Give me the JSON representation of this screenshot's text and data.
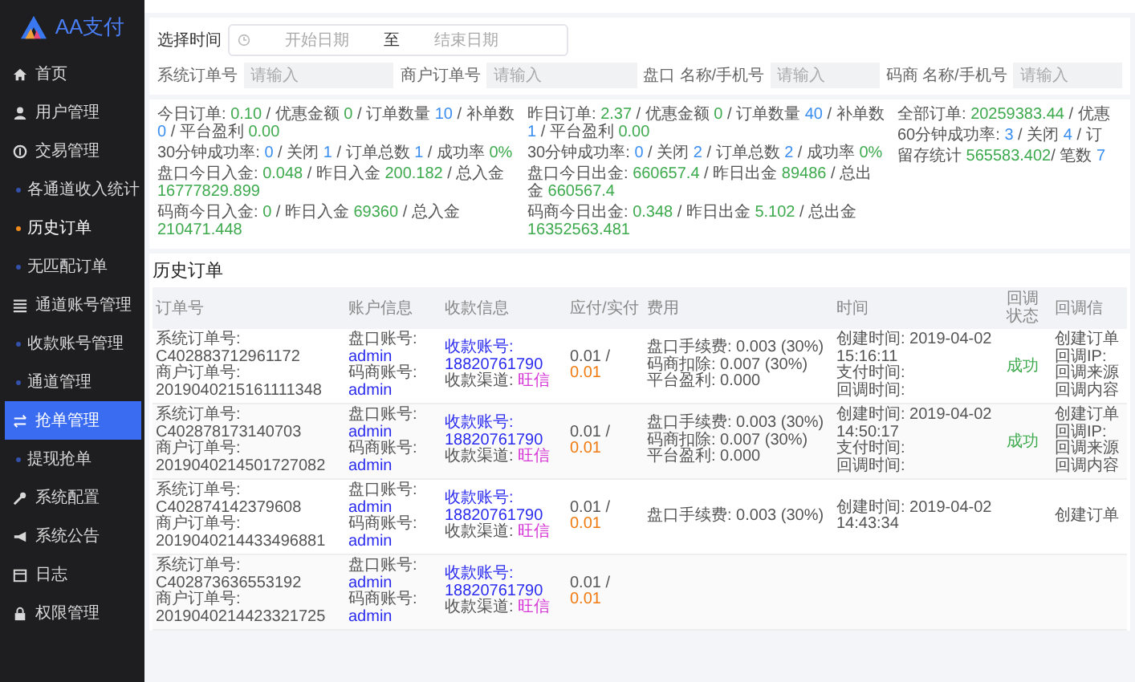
{
  "sidebar": {
    "logo": "AA支付",
    "items": [
      {
        "label": "首页",
        "selected": false
      },
      {
        "label": "用户管理",
        "selected": false
      },
      {
        "label": "交易管理",
        "selected": false,
        "children": [
          {
            "label": "各通道收入统计",
            "selected": false
          },
          {
            "label": "历史订单",
            "selected": true
          },
          {
            "label": "无匹配订单",
            "selected": false
          }
        ]
      },
      {
        "label": "通道账号管理",
        "selected": false,
        "children": [
          {
            "label": "收款账号管理",
            "selected": false
          },
          {
            "label": "通道管理",
            "selected": false
          }
        ]
      },
      {
        "label": "抢单管理",
        "selected": true,
        "children": [
          {
            "label": "提现抢单",
            "selected": false
          }
        ]
      },
      {
        "label": "系统配置",
        "selected": false
      },
      {
        "label": "系统公告",
        "selected": false
      },
      {
        "label": "日志",
        "selected": false
      },
      {
        "label": "权限管理",
        "selected": false
      }
    ]
  },
  "filters": {
    "date_label": "选择时间",
    "start_placeholder": "开始日期",
    "separator": "至",
    "end_placeholder": "结束日期",
    "fields": [
      {
        "label": "系统订单号",
        "placeholder": "请输入"
      },
      {
        "label": "商户订单号",
        "placeholder": "请输入"
      },
      {
        "label": "盘口 名称/手机号",
        "placeholder": "请输入"
      },
      {
        "label": "码商 名称/手机号",
        "placeholder": "请输入"
      }
    ]
  },
  "stats": {
    "columns": [
      [
        [
          {
            "text": "今日订单: ",
            "kind": "plain"
          },
          {
            "text": "0.10",
            "kind": "green"
          },
          {
            "text": " / 优惠金额 ",
            "kind": "plain"
          },
          {
            "text": "0",
            "kind": "green"
          },
          {
            "text": " / 订单数量 ",
            "kind": "plain"
          },
          {
            "text": "10",
            "kind": "blue"
          },
          {
            "text": " / 补单数 ",
            "kind": "plain"
          },
          {
            "text": "0",
            "kind": "blue"
          },
          {
            "text": " / 平台盈利 ",
            "kind": "plain"
          },
          {
            "text": "0.00",
            "kind": "green"
          }
        ],
        [
          {
            "text": "30分钟成功率: ",
            "kind": "plain"
          },
          {
            "text": "0",
            "kind": "blue"
          },
          {
            "text": " / 关闭 ",
            "kind": "plain"
          },
          {
            "text": "1",
            "kind": "blue"
          },
          {
            "text": " / 订单总数 ",
            "kind": "plain"
          },
          {
            "text": "1",
            "kind": "blue"
          },
          {
            "text": " / 成功率 ",
            "kind": "plain"
          },
          {
            "text": "0%",
            "kind": "green"
          }
        ],
        [
          {
            "text": "盘口今日入金: ",
            "kind": "plain"
          },
          {
            "text": "0.048",
            "kind": "green"
          },
          {
            "text": " / 昨日入金 ",
            "kind": "plain"
          },
          {
            "text": "200.182",
            "kind": "green"
          },
          {
            "text": " / 总入金 ",
            "kind": "plain"
          },
          {
            "text": "16777829.899",
            "kind": "green"
          }
        ],
        [
          {
            "text": "码商今日入金: ",
            "kind": "plain"
          },
          {
            "text": "0",
            "kind": "green"
          },
          {
            "text": " / 昨日入金 ",
            "kind": "plain"
          },
          {
            "text": "69360",
            "kind": "green"
          },
          {
            "text": " / 总入金 ",
            "kind": "plain"
          },
          {
            "text": "210471.448",
            "kind": "green"
          }
        ]
      ],
      [
        [
          {
            "text": "昨日订单: ",
            "kind": "plain"
          },
          {
            "text": "2.37",
            "kind": "green"
          },
          {
            "text": " / 优惠金额 ",
            "kind": "plain"
          },
          {
            "text": "0",
            "kind": "green"
          },
          {
            "text": " / 订单数量 ",
            "kind": "plain"
          },
          {
            "text": "40",
            "kind": "blue"
          },
          {
            "text": " / 补单数 ",
            "kind": "plain"
          },
          {
            "text": "1",
            "kind": "blue"
          },
          {
            "text": " / 平台盈利 ",
            "kind": "plain"
          },
          {
            "text": "0.00",
            "kind": "green"
          }
        ],
        [
          {
            "text": "30分钟成功率: ",
            "kind": "plain"
          },
          {
            "text": "0",
            "kind": "blue"
          },
          {
            "text": " / 关闭 ",
            "kind": "plain"
          },
          {
            "text": "2",
            "kind": "blue"
          },
          {
            "text": " / 订单总数 ",
            "kind": "plain"
          },
          {
            "text": "2",
            "kind": "blue"
          },
          {
            "text": " / 成功率 ",
            "kind": "plain"
          },
          {
            "text": "0%",
            "kind": "green"
          }
        ],
        [
          {
            "text": "盘口今日出金: ",
            "kind": "plain"
          },
          {
            "text": "660657.4",
            "kind": "green"
          },
          {
            "text": " / 昨日出金 ",
            "kind": "plain"
          },
          {
            "text": "89486",
            "kind": "green"
          },
          {
            "text": " / 总出金 ",
            "kind": "plain"
          },
          {
            "text": "660567.4",
            "kind": "green"
          }
        ],
        [
          {
            "text": "码商今日出金: ",
            "kind": "plain"
          },
          {
            "text": "0.348",
            "kind": "green"
          },
          {
            "text": " / 昨日出金 ",
            "kind": "plain"
          },
          {
            "text": "5.102",
            "kind": "green"
          },
          {
            "text": " / 总出金 ",
            "kind": "plain"
          },
          {
            "text": "16352563.481",
            "kind": "green"
          }
        ]
      ],
      [
        [
          {
            "text": "全部订单: ",
            "kind": "plain"
          },
          {
            "text": "20259383.44",
            "kind": "green"
          },
          {
            "text": " / 优惠",
            "kind": "plain"
          }
        ],
        [
          {
            "text": "60分钟成功率: ",
            "kind": "plain"
          },
          {
            "text": "3",
            "kind": "blue"
          },
          {
            "text": " / 关闭 ",
            "kind": "plain"
          },
          {
            "text": "4",
            "kind": "blue"
          },
          {
            "text": " / 订",
            "kind": "plain"
          }
        ],
        [
          {
            "text": "留存统计 ",
            "kind": "plain"
          },
          {
            "text": "565583.402",
            "kind": "green"
          },
          {
            "text": "/ 笔数 ",
            "kind": "plain"
          },
          {
            "text": "7",
            "kind": "blue"
          }
        ]
      ]
    ]
  },
  "history": {
    "title": "历史订单",
    "columns": [
      "订单号",
      "账户信息",
      "收款信息",
      "应付/实付",
      "费用",
      "时间",
      "回调状态",
      "回调信"
    ],
    "rows": [
      {
        "order": [
          [
            {
              "text": "系统订单号: C402883712961172",
              "kind": "plain"
            }
          ],
          [
            {
              "text": "商户订单号: 2019040215161111348",
              "kind": "plain"
            }
          ]
        ],
        "account": [
          [
            {
              "text": "盘口账号: ",
              "kind": "plain"
            },
            {
              "text": "admin",
              "kind": "link"
            }
          ],
          [
            {
              "text": "码商账号: ",
              "kind": "plain"
            },
            {
              "text": "admin",
              "kind": "link"
            }
          ]
        ],
        "receipt": [
          [
            {
              "text": "收款账号: 18820761790",
              "kind": "link"
            }
          ],
          [
            {
              "text": "收款渠道: ",
              "kind": "plain"
            },
            {
              "text": "旺信",
              "kind": "pink"
            }
          ]
        ],
        "amount": [
          [
            {
              "text": "0.01 / ",
              "kind": "plain"
            },
            {
              "text": "0.01",
              "kind": "orange"
            }
          ]
        ],
        "fees": [
          [
            {
              "text": "盘口手续费: 0.003 (30%)",
              "kind": "plain"
            }
          ],
          [
            {
              "text": "码商扣除: 0.007 (30%)",
              "kind": "plain"
            }
          ],
          [
            {
              "text": "平台盈利: 0.000",
              "kind": "plain"
            }
          ]
        ],
        "times": [
          [
            {
              "text": "创建时间: 2019-04-02 15:16:11",
              "kind": "plain"
            }
          ],
          [
            {
              "text": "支付时间:",
              "kind": "plain"
            }
          ],
          [
            {
              "text": "回调时间:",
              "kind": "plain"
            }
          ]
        ],
        "status": "成功",
        "callback": [
          [
            {
              "text": "创建订单",
              "kind": "plain"
            }
          ],
          [
            {
              "text": "回调IP:",
              "kind": "plain"
            }
          ],
          [
            {
              "text": "回调来源",
              "kind": "plain"
            }
          ],
          [
            {
              "text": "回调内容",
              "kind": "plain"
            }
          ]
        ]
      },
      {
        "order": [
          [
            {
              "text": "系统订单号: C402878173140703",
              "kind": "plain"
            }
          ],
          [
            {
              "text": "商户订单号: 2019040214501727082",
              "kind": "plain"
            }
          ]
        ],
        "account": [
          [
            {
              "text": "盘口账号: ",
              "kind": "plain"
            },
            {
              "text": "admin",
              "kind": "link"
            }
          ],
          [
            {
              "text": "码商账号: ",
              "kind": "plain"
            },
            {
              "text": "admin",
              "kind": "link"
            }
          ]
        ],
        "receipt": [
          [
            {
              "text": "收款账号: 18820761790",
              "kind": "link"
            }
          ],
          [
            {
              "text": "收款渠道: ",
              "kind": "plain"
            },
            {
              "text": "旺信",
              "kind": "pink"
            }
          ]
        ],
        "amount": [
          [
            {
              "text": "0.01 / ",
              "kind": "plain"
            },
            {
              "text": "0.01",
              "kind": "orange"
            }
          ]
        ],
        "fees": [
          [
            {
              "text": "盘口手续费: 0.003 (30%)",
              "kind": "plain"
            }
          ],
          [
            {
              "text": "码商扣除: 0.007 (30%)",
              "kind": "plain"
            }
          ],
          [
            {
              "text": "平台盈利: 0.000",
              "kind": "plain"
            }
          ]
        ],
        "times": [
          [
            {
              "text": "创建时间: 2019-04-02 14:50:17",
              "kind": "plain"
            }
          ],
          [
            {
              "text": "支付时间:",
              "kind": "plain"
            }
          ],
          [
            {
              "text": "回调时间:",
              "kind": "plain"
            }
          ]
        ],
        "status": "成功",
        "callback": [
          [
            {
              "text": "创建订单",
              "kind": "plain"
            }
          ],
          [
            {
              "text": "回调IP:",
              "kind": "plain"
            }
          ],
          [
            {
              "text": "回调来源",
              "kind": "plain"
            }
          ],
          [
            {
              "text": "回调内容",
              "kind": "plain"
            }
          ]
        ]
      },
      {
        "order": [
          [
            {
              "text": "系统订单号: C402874142379608",
              "kind": "plain"
            }
          ],
          [
            {
              "text": "商户订单号: 2019040214433496881",
              "kind": "plain"
            }
          ]
        ],
        "account": [
          [
            {
              "text": "盘口账号: ",
              "kind": "plain"
            },
            {
              "text": "admin",
              "kind": "link"
            }
          ],
          [
            {
              "text": "码商账号: ",
              "kind": "plain"
            },
            {
              "text": "admin",
              "kind": "link"
            }
          ]
        ],
        "receipt": [
          [
            {
              "text": "收款账号: 18820761790",
              "kind": "link"
            }
          ],
          [
            {
              "text": "收款渠道: ",
              "kind": "plain"
            },
            {
              "text": "旺信",
              "kind": "pink"
            }
          ]
        ],
        "amount": [
          [
            {
              "text": "0.01 / ",
              "kind": "plain"
            },
            {
              "text": "0.01",
              "kind": "orange"
            }
          ]
        ],
        "fees": [
          [
            {
              "text": "盘口手续费: 0.003 (30%)",
              "kind": "plain"
            }
          ]
        ],
        "times": [
          [
            {
              "text": "创建时间: 2019-04-02 14:43:34",
              "kind": "plain"
            }
          ]
        ],
        "callback": [
          [
            {
              "text": "创建订单",
              "kind": "plain"
            }
          ]
        ]
      },
      {
        "order": [
          [
            {
              "text": "系统订单号: C402873636553192",
              "kind": "plain"
            }
          ],
          [
            {
              "text": "商户订单号: 2019040214423321725",
              "kind": "plain"
            }
          ]
        ],
        "account": [
          [
            {
              "text": "盘口账号: ",
              "kind": "plain"
            },
            {
              "text": "admin",
              "kind": "link"
            }
          ],
          [
            {
              "text": "码商账号: ",
              "kind": "plain"
            },
            {
              "text": "admin",
              "kind": "link"
            }
          ]
        ],
        "receipt": [
          [
            {
              "text": "收款账号: 18820761790",
              "kind": "link"
            }
          ],
          [
            {
              "text": "收款渠道: ",
              "kind": "plain"
            },
            {
              "text": "旺信",
              "kind": "pink"
            }
          ]
        ],
        "amount": [
          [
            {
              "text": "0.01 / ",
              "kind": "plain"
            },
            {
              "text": "0.01",
              "kind": "orange"
            }
          ]
        ]
      }
    ]
  }
}
